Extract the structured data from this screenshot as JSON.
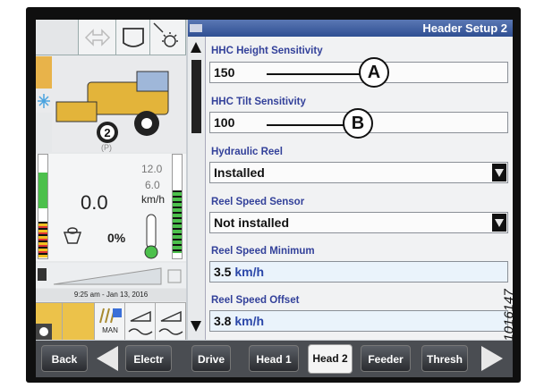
{
  "header": {
    "title": "Header Setup 2"
  },
  "left_panel": {
    "speed_value": "0.0",
    "speed_max": "12.0",
    "speed_mid": "6.0",
    "speed_unit": "km/h",
    "percent": "0%",
    "gear": "2",
    "park": "(P)",
    "datetime": "9:25 am - Jan 13, 2016",
    "man_label": "MAN"
  },
  "fields": {
    "hhc_height": {
      "label": "HHC Height Sensitivity",
      "value": "150"
    },
    "hhc_tilt": {
      "label": "HHC Tilt Sensitivity",
      "value": "100"
    },
    "hydraulic_reel": {
      "label": "Hydraulic Reel",
      "value": "Installed"
    },
    "reel_sensor": {
      "label": "Reel Speed Sensor",
      "value": "Not installed"
    },
    "reel_min": {
      "label": "Reel Speed Minimum",
      "value": "3.5",
      "unit": "km/h"
    },
    "reel_offset": {
      "label": "Reel Speed Offset",
      "value": "3.8",
      "unit": "km/h"
    }
  },
  "callouts": {
    "a": "A",
    "b": "B"
  },
  "nav": {
    "back": "Back",
    "tabs": [
      "Electr",
      "Drive",
      "Head 1",
      "Head 2",
      "Feeder",
      "Thresh"
    ],
    "active_tab": "Head 2"
  },
  "figure_id": "1016147",
  "colors": {
    "title_bar": "#2f4f92",
    "label_blue": "#33419a",
    "warning": "#e8b34a",
    "green": "#4cc04c"
  },
  "icons": [
    "arrow-icon",
    "header-icon",
    "light-icon",
    "harvester-icon",
    "fuel-icon",
    "thermometer-icon",
    "reel-icon"
  ]
}
